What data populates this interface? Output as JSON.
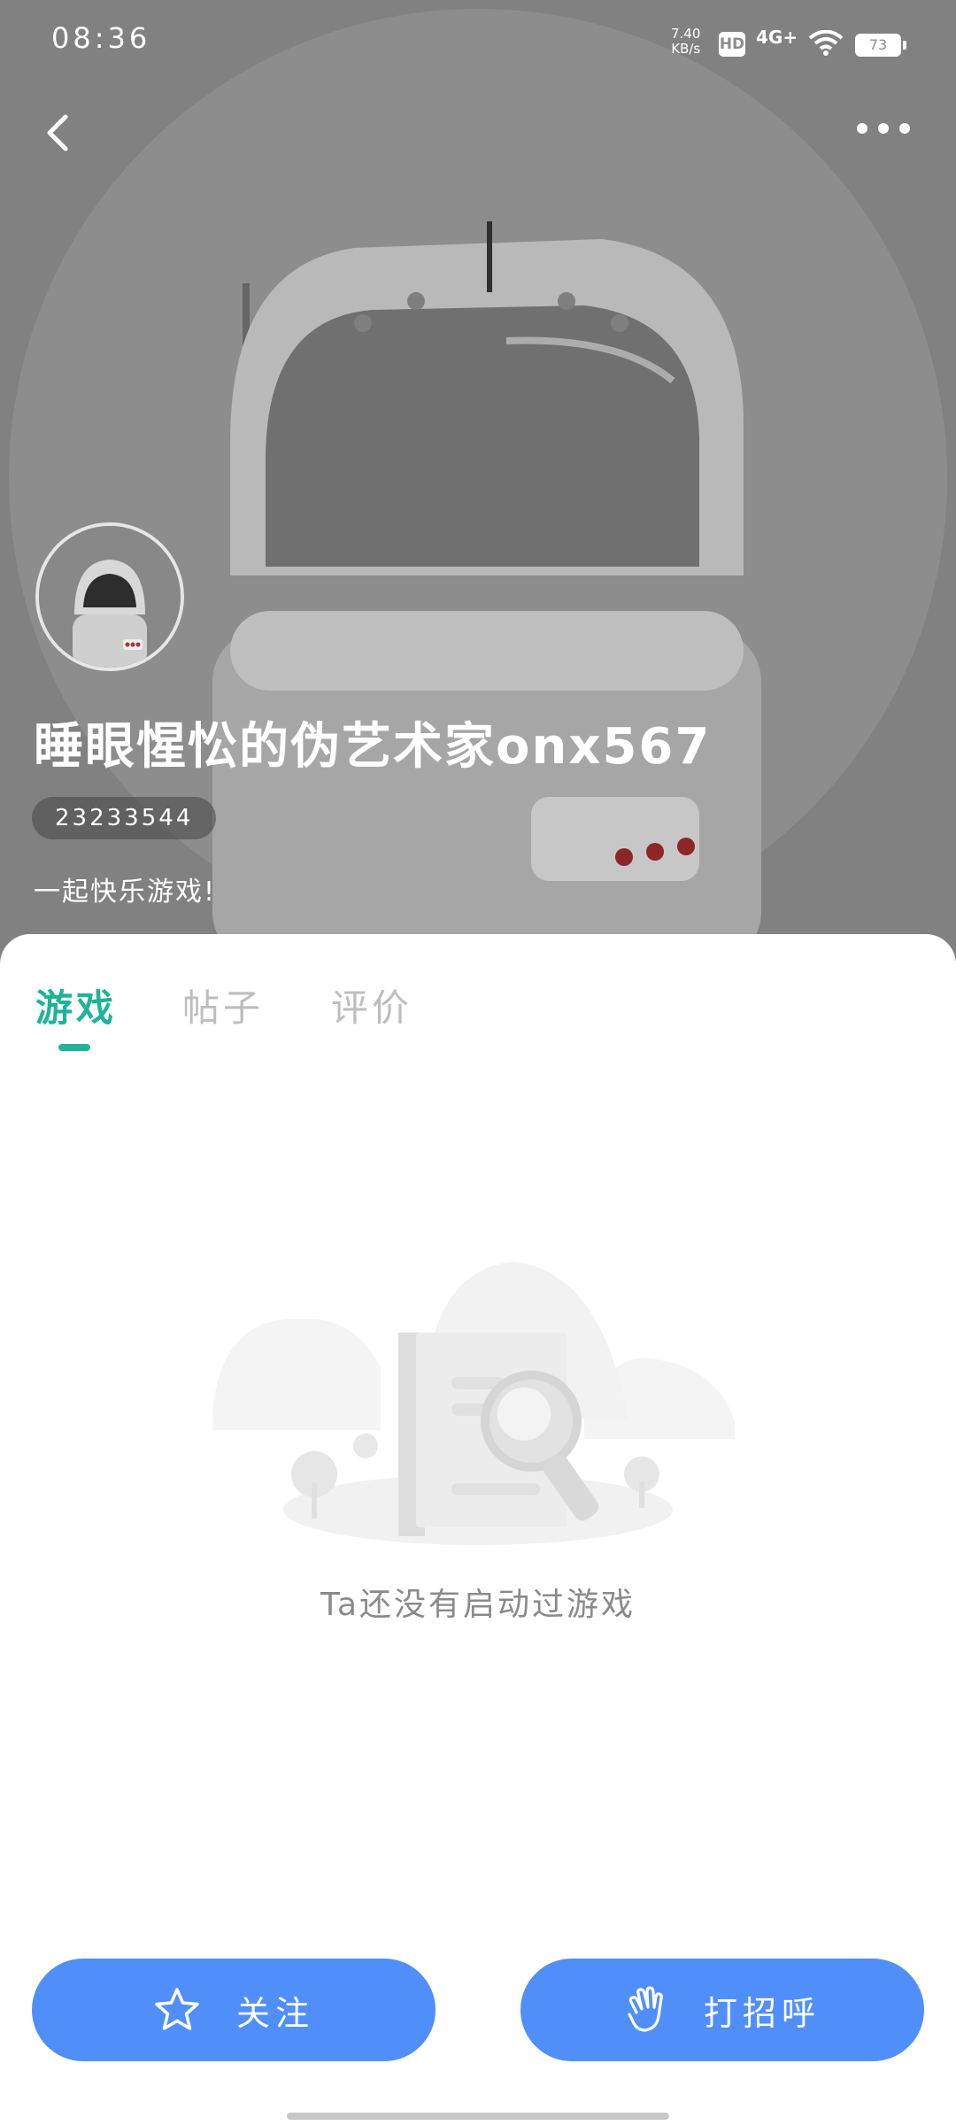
{
  "status_bar": {
    "time": "08:36",
    "net_speed": "7.40",
    "net_speed_unit": "KB/s",
    "hd": "HD",
    "network": "4G+",
    "battery": "73"
  },
  "profile": {
    "username": "睡眼惺忪的伪艺术家onx567",
    "user_id": "23233544",
    "bio": "一起快乐游戏!"
  },
  "tabs": [
    {
      "label": "游戏",
      "active": true
    },
    {
      "label": "帖子",
      "active": false
    },
    {
      "label": "评价",
      "active": false
    }
  ],
  "empty_state": {
    "text": "Ta还没有启动过游戏"
  },
  "actions": {
    "follow_label": "关注",
    "greet_label": "打招呼"
  },
  "colors": {
    "accent": "#1fb39a",
    "button": "#508ffa",
    "banner": "#8d8d8d"
  },
  "icons": [
    "back-icon",
    "more-icon",
    "star-icon",
    "wave-hand-icon",
    "wifi-icon",
    "battery-icon"
  ]
}
